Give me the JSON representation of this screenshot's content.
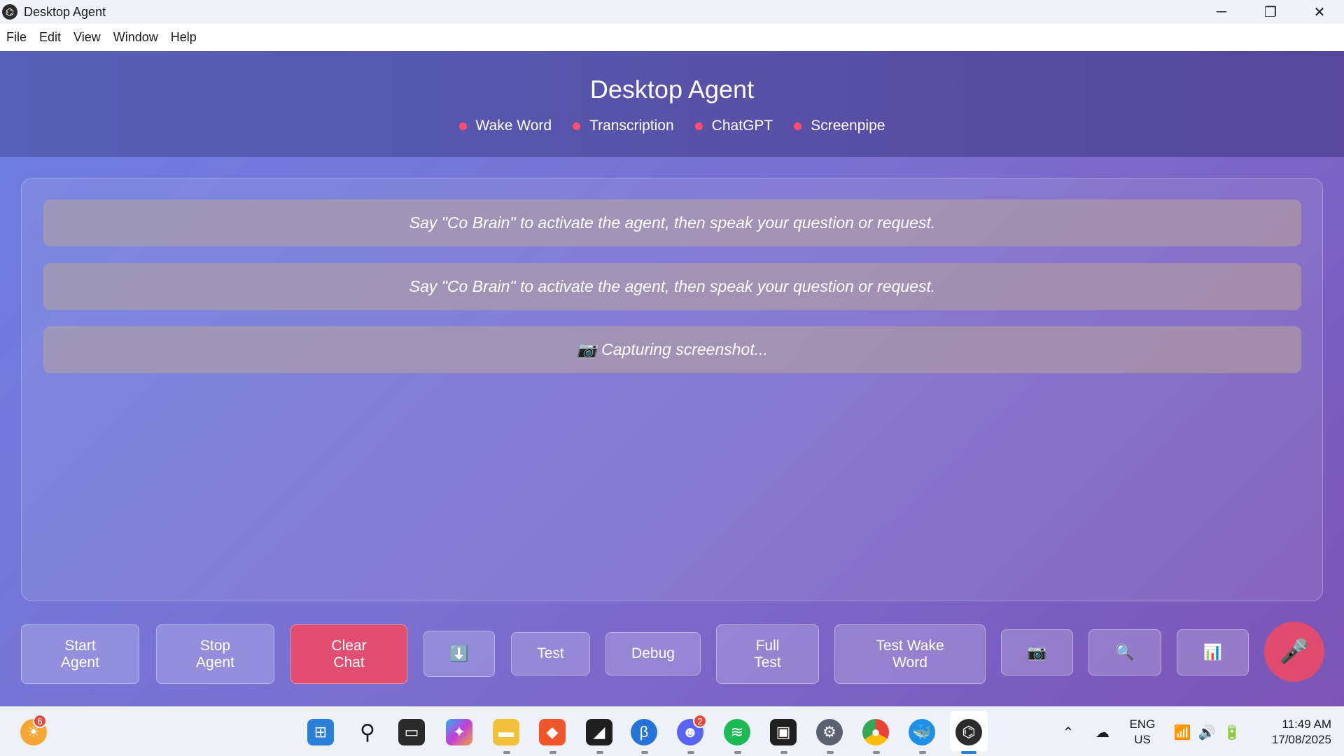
{
  "window": {
    "title": "Desktop Agent",
    "controls": {
      "minimize": "─",
      "restore": "❐",
      "close": "✕"
    }
  },
  "menu": [
    "File",
    "Edit",
    "View",
    "Window",
    "Help"
  ],
  "header": {
    "title": "Desktop Agent",
    "status": [
      {
        "label": "Wake Word",
        "color": "#ff4d6d"
      },
      {
        "label": "Transcription",
        "color": "#ff4d6d"
      },
      {
        "label": "ChatGPT",
        "color": "#ff4d6d"
      },
      {
        "label": "Screenpipe",
        "color": "#ff4d6d"
      }
    ]
  },
  "chat": {
    "messages": [
      "Say \"Co Brain\" to activate the agent, then speak your question or request.",
      "Say \"Co Brain\" to activate the agent, then speak your question or request.",
      "📷 Capturing screenshot..."
    ]
  },
  "controls": {
    "start_agent": "Start\nAgent",
    "stop_agent": "Stop\nAgent",
    "clear_chat": "Clear\nChat",
    "download_icon": "⬇️",
    "test": "Test",
    "debug": "Debug",
    "full_test": "Full\nTest",
    "test_wake_word": "Test Wake\nWord",
    "camera_icon": "📷",
    "search_icon": "🔍",
    "chart_icon": "📊",
    "mic_icon": "🎤"
  },
  "taskbar": {
    "weather_badge": "6",
    "discord_badge": "2",
    "language": "ENG",
    "region": "US",
    "time": "11:49 AM",
    "date": "17/08/2025",
    "icons": [
      "start-icon",
      "search-icon",
      "task-view-icon",
      "copilot-icon",
      "file-explorer-icon",
      "brave-icon",
      "sticky-notes-icon",
      "edge-beta-icon",
      "discord-icon",
      "spotify-icon",
      "notion-icon",
      "settings-icon",
      "chrome-icon",
      "docker-icon",
      "desktop-agent-icon"
    ]
  },
  "colors": {
    "accent_red": "#e24d72",
    "status_dot": "#ff4d6d",
    "header_bg": "#5561b6"
  }
}
